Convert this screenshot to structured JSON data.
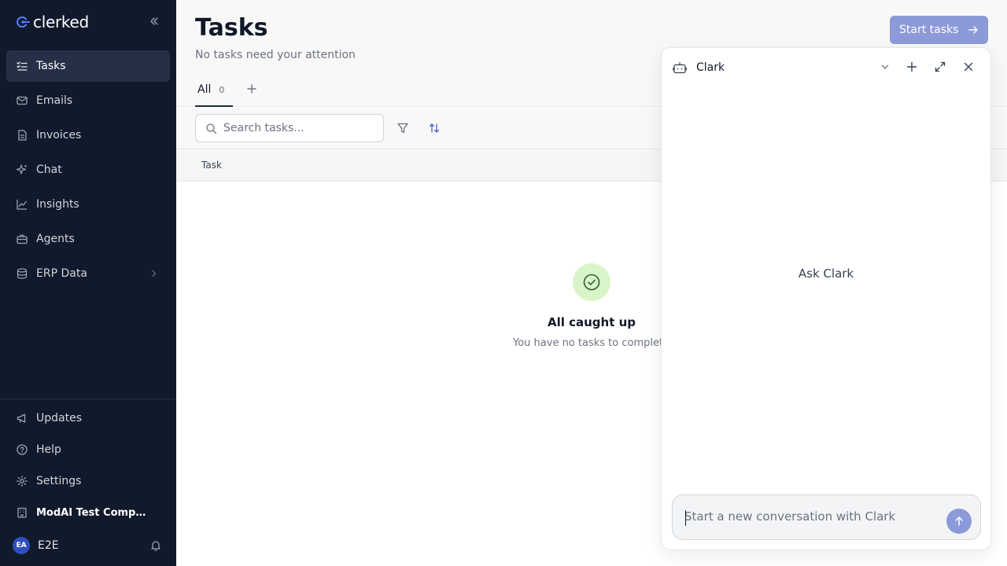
{
  "sidebar": {
    "logo_text": "clerked",
    "nav_items": [
      {
        "label": "Tasks",
        "icon": "tasks-list-icon",
        "active": true
      },
      {
        "label": "Emails",
        "icon": "mail-icon"
      },
      {
        "label": "Invoices",
        "icon": "document-icon"
      },
      {
        "label": "Chat",
        "icon": "sparkle-icon"
      },
      {
        "label": "Insights",
        "icon": "line-chart-icon"
      },
      {
        "label": "Agents",
        "icon": "briefcase-icon"
      },
      {
        "label": "ERP Data",
        "icon": "database-icon",
        "has_submenu": true
      }
    ],
    "bottom_items": [
      {
        "label": "Updates",
        "icon": "megaphone-icon"
      },
      {
        "label": "Help",
        "icon": "help-circle-icon"
      },
      {
        "label": "Settings",
        "icon": "gear-icon"
      },
      {
        "label": "ModAI Test Compa...",
        "icon": "building-icon"
      }
    ],
    "user": {
      "initials": "EA",
      "name": "E2E"
    }
  },
  "header": {
    "title": "Tasks",
    "subtitle": "No tasks need your attention",
    "start_button": "Start tasks"
  },
  "tabs": [
    {
      "label": "All",
      "count": "0"
    }
  ],
  "toolbar": {
    "search_placeholder": "Search tasks..."
  },
  "table": {
    "columns": [
      "Task"
    ]
  },
  "empty_state": {
    "title": "All caught up",
    "subtitle": "You have no tasks to complete"
  },
  "chat": {
    "title": "Clark",
    "empty_prompt": "Ask Clark",
    "input_placeholder": "Start a new conversation with Clark"
  },
  "colors": {
    "sidebar_bg": "#111a2c",
    "accent": "#8d9ad9",
    "success_bg": "#d9f5c8"
  }
}
